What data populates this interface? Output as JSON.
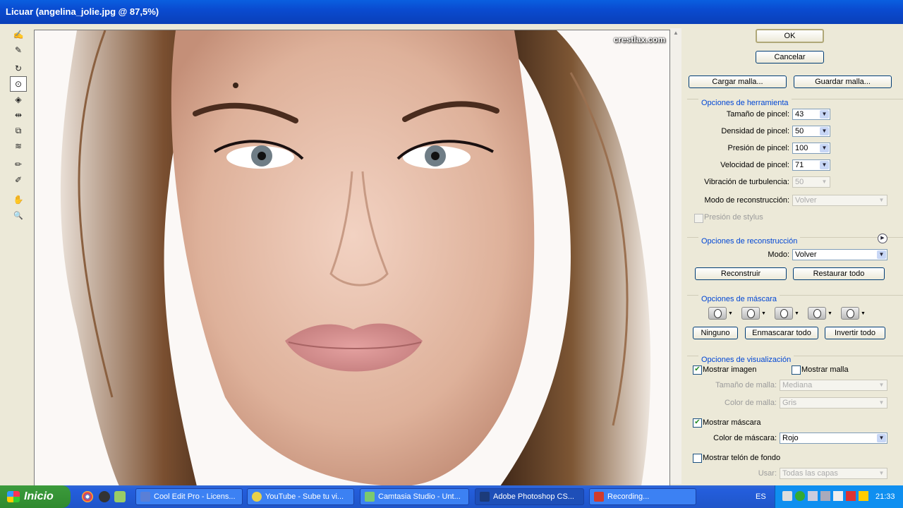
{
  "window": {
    "title": "Licuar (angelina_jolie.jpg @ 87,5%)"
  },
  "preview": {
    "watermark": "crestlax.com"
  },
  "toolbar": {
    "tools": [
      {
        "name": "forward-warp-tool-icon",
        "glyph": "✍"
      },
      {
        "name": "reconstruct-tool-icon",
        "glyph": "✎"
      },
      {
        "name": "twirl-clockwise-tool-icon",
        "glyph": "↻"
      },
      {
        "name": "pucker-tool-icon",
        "glyph": "⊙"
      },
      {
        "name": "bloat-tool-icon",
        "glyph": "◈"
      },
      {
        "name": "push-left-tool-icon",
        "glyph": "⇹"
      },
      {
        "name": "mirror-tool-icon",
        "glyph": "⧉"
      },
      {
        "name": "turbulence-tool-icon",
        "glyph": "≋"
      },
      {
        "name": "freeze-mask-tool-icon",
        "glyph": "✏"
      },
      {
        "name": "thaw-mask-tool-icon",
        "glyph": "✐"
      },
      {
        "name": "hand-tool-icon",
        "glyph": "✋"
      },
      {
        "name": "zoom-tool-icon",
        "glyph": "🔍"
      }
    ]
  },
  "buttons": {
    "ok": "OK",
    "cancel": "Cancelar",
    "load_mesh": "Cargar malla...",
    "save_mesh": "Guardar malla..."
  },
  "tool_options": {
    "header": "Opciones de herramienta",
    "brush_size_label": "Tamaño de pincel:",
    "brush_size": "43",
    "brush_density_label": "Densidad de pincel:",
    "brush_density": "50",
    "brush_pressure_label": "Presión de pincel:",
    "brush_pressure": "100",
    "brush_rate_label": "Velocidad de pincel:",
    "brush_rate": "71",
    "turbulent_jitter_label": "Vibración de turbulencia:",
    "turbulent_jitter": "50",
    "reconstruct_mode_label": "Modo de reconstrucción:",
    "reconstruct_mode": "Volver",
    "stylus_pressure_label": "Presión de stylus"
  },
  "reconstruct_options": {
    "header": "Opciones de reconstrucción",
    "mode_label": "Modo:",
    "mode": "Volver",
    "reconstruct": "Reconstruir",
    "restore_all": "Restaurar todo"
  },
  "mask_options": {
    "header": "Opciones de máscara",
    "none": "Ninguno",
    "mask_all": "Enmascarar todo",
    "invert_all": "Invertir todo"
  },
  "view_options": {
    "header": "Opciones de visualización",
    "show_image": "Mostrar imagen",
    "show_mesh": "Mostrar malla",
    "mesh_size_label": "Tamaño de malla:",
    "mesh_size": "Mediana",
    "mesh_color_label": "Color de malla:",
    "mesh_color": "Gris",
    "show_mask": "Mostrar máscara",
    "mask_color_label": "Color de máscara:",
    "mask_color": "Rojo",
    "show_backdrop": "Mostrar telón de fondo",
    "use_label": "Usar:",
    "use": "Todas las capas"
  },
  "taskbar": {
    "start": "Inicio",
    "tasks": [
      {
        "label": "Cool Edit Pro - Licens...",
        "color": "#5a7fd6"
      },
      {
        "label": "YouTube - Sube tu vi...",
        "color": "#e8d04a"
      },
      {
        "label": "Camtasia Studio - Unt...",
        "color": "#7bc96f"
      },
      {
        "label": "Adobe Photoshop CS...",
        "color": "#1c3b7a"
      },
      {
        "label": "Recording...",
        "color": "#d23b2b"
      }
    ],
    "language": "ES",
    "clock": "21:33"
  }
}
